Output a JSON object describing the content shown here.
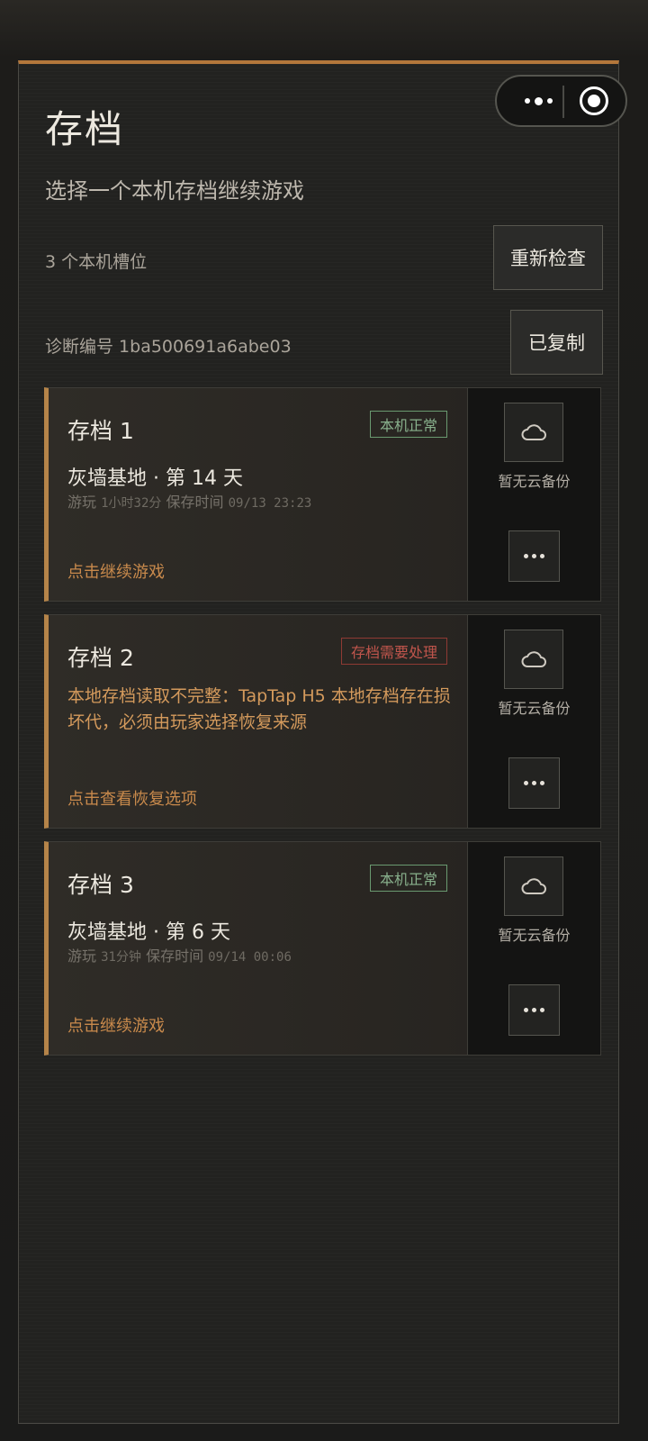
{
  "header": {
    "title": "存档",
    "subtitle": "选择一个本机存档继续游戏",
    "slot_count": "3 个本机槽位",
    "recheck_label": "重新检查",
    "diagnostic": "诊断编号 1ba500691a6abe03",
    "copied_label": "已复制"
  },
  "slots": [
    {
      "name": "存档 1",
      "badge": "本机正常",
      "base": "灰墙基地 · 第 14 天",
      "play_label": "游玩",
      "play_time": "1小时32分",
      "save_label": "保存时间",
      "save_time": "09/13 23:23",
      "action": "点击继续游戏",
      "cloud_status": "暂无云备份"
    },
    {
      "name": "存档 2",
      "badge": "存档需要处理",
      "warning": "本地存档读取不完整：TapTap H5 本地存档存在损坏代，必须由玩家选择恢复来源",
      "action": "点击查看恢复选项",
      "cloud_status": "暂无云备份"
    },
    {
      "name": "存档 3",
      "badge": "本机正常",
      "base": "灰墙基地 · 第 6 天",
      "play_label": "游玩",
      "play_time": "31分钟",
      "save_label": "保存时间",
      "save_time": "09/14 00:06",
      "action": "点击继续游戏",
      "cloud_status": "暂无云备份"
    }
  ],
  "icons": {
    "cloud": "cloud-icon",
    "more": "more-icon",
    "menu": "more-dots-icon",
    "close": "target-icon"
  },
  "colors": {
    "accent": "#b3773b",
    "ok": "#88b08c",
    "error": "#c0554c",
    "action": "#c98a4c"
  }
}
